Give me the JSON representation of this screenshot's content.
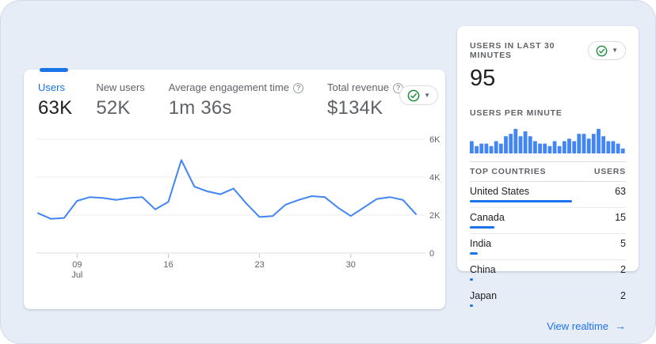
{
  "colors": {
    "accent_blue": "#1a73e8",
    "chart_blue": "#4285f4",
    "success_green": "#1e8e3e",
    "text_dark": "#202124",
    "text_gray": "#5f6368",
    "background": "#e7edf6"
  },
  "overview": {
    "tabs": [
      {
        "label": "Users",
        "value": "63K",
        "selected": true,
        "help": false
      },
      {
        "label": "New users",
        "value": "52K",
        "selected": false,
        "help": false
      },
      {
        "label": "Average engagement time",
        "value": "1m 36s",
        "selected": false,
        "help": true
      },
      {
        "label": "Total revenue",
        "value": "$134K",
        "selected": false,
        "help": true
      }
    ],
    "status_pill": {
      "icon": "check-circle",
      "caret": "▼"
    }
  },
  "chart_data": [
    {
      "type": "line",
      "title": "Users over time",
      "series": [
        {
          "name": "Users",
          "values": [
            2100,
            1800,
            1850,
            2750,
            2950,
            2900,
            2800,
            2900,
            2950,
            2300,
            2700,
            4900,
            3500,
            3250,
            3100,
            3400,
            2600,
            1900,
            1950,
            2550,
            2800,
            3000,
            2950,
            2400,
            1950,
            2400,
            2850,
            2950,
            2800,
            2050
          ]
        }
      ],
      "ylim": [
        0,
        6000
      ],
      "yticks": [
        {
          "value": 0,
          "label": "0"
        },
        {
          "value": 2000,
          "label": "2K"
        },
        {
          "value": 4000,
          "label": "4K"
        },
        {
          "value": 6000,
          "label": "6K"
        }
      ],
      "xticks": [
        {
          "index": 3,
          "label": "09",
          "sublabel": "Jul"
        },
        {
          "index": 10,
          "label": "16",
          "sublabel": ""
        },
        {
          "index": 17,
          "label": "23",
          "sublabel": ""
        },
        {
          "index": 24,
          "label": "30",
          "sublabel": ""
        }
      ],
      "grid": true,
      "y_axis_side": "right",
      "legend": "none",
      "line_color": "#4285f4"
    },
    {
      "type": "bar",
      "title": "USERS PER MINUTE",
      "values": [
        5,
        3,
        4,
        4,
        3,
        5,
        4,
        7,
        8,
        10,
        7,
        9,
        7,
        5,
        4,
        4,
        3,
        5,
        3,
        5,
        6,
        5,
        8,
        8,
        6,
        8,
        10,
        7,
        5,
        5,
        4,
        2
      ],
      "ylim": [
        0,
        10
      ],
      "bar_color": "#4285f4"
    }
  ],
  "realtime": {
    "users_30min_label": "USERS IN LAST 30 MINUTES",
    "users_30min_value": "95",
    "per_minute_label": "USERS PER MINUTE",
    "status_pill": {
      "icon": "check-circle",
      "caret": "▼"
    },
    "countries": {
      "header_country": "TOP COUNTRIES",
      "header_users": "USERS",
      "rows": [
        {
          "name": "United States",
          "users": 63
        },
        {
          "name": "Canada",
          "users": 15
        },
        {
          "name": "India",
          "users": 5
        },
        {
          "name": "China",
          "users": 2
        },
        {
          "name": "Japan",
          "users": 2
        }
      ]
    },
    "view_realtime_label": "View realtime",
    "arrow": "→"
  }
}
